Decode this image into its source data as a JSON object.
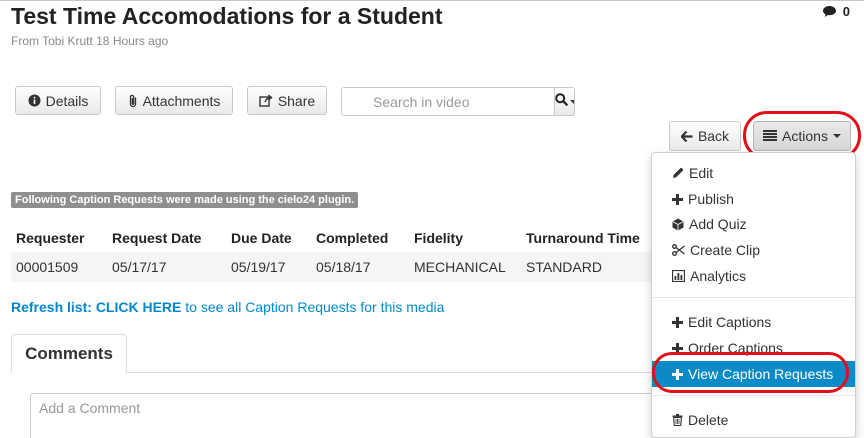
{
  "header": {
    "title": "Test Time Accomodations for a Student",
    "meta": "From Tobi Krutt 18 Hours ago",
    "comment_count": "0"
  },
  "toolbar": {
    "details_label": "Details",
    "attachments_label": "Attachments",
    "share_label": "Share",
    "search_placeholder": "Search in video",
    "back_label": "Back",
    "actions_label": "Actions"
  },
  "captions": {
    "banner": "Following Caption Requests were made using the cielo24 plugin.",
    "columns": [
      "Requester",
      "Request Date",
      "Due Date",
      "Completed",
      "Fidelity",
      "Turnaround Time"
    ],
    "rows": [
      [
        "00001509",
        "05/17/17",
        "05/19/17",
        "05/18/17",
        "MECHANICAL",
        "STANDARD"
      ]
    ],
    "refresh_label": "Refresh list:",
    "refresh_link": "CLICK HERE",
    "refresh_suffix": "to see all Caption Requests for this media"
  },
  "comments": {
    "tab_label": "Comments",
    "placeholder": "Add a Comment"
  },
  "actions_menu": {
    "items": [
      {
        "label": "Edit",
        "icon": "pencil-icon"
      },
      {
        "label": "Publish",
        "icon": "plus-icon"
      },
      {
        "label": "Add Quiz",
        "icon": "cube-icon"
      },
      {
        "label": "Create Clip",
        "icon": "scissors-icon"
      },
      {
        "label": "Analytics",
        "icon": "bar-chart-icon"
      },
      {
        "label": "Edit Captions",
        "icon": "plus-icon"
      },
      {
        "label": "Order Captions",
        "icon": "plus-icon"
      },
      {
        "label": "View Caption Requests",
        "icon": "plus-icon",
        "active": true
      },
      {
        "label": "Delete",
        "icon": "trash-icon"
      }
    ]
  },
  "colors": {
    "link": "#0088cc",
    "active_item": "#0a8bc8",
    "highlight": "#e0101a"
  }
}
